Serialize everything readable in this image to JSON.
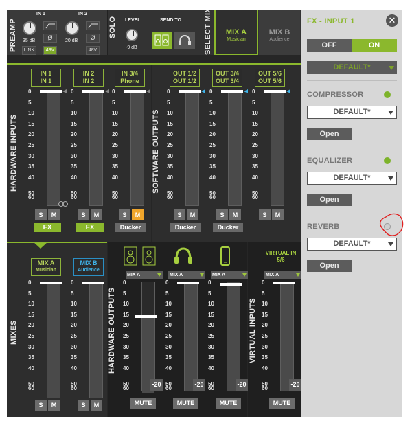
{
  "preamp": {
    "label": "PREAMP",
    "in1": "IN 1",
    "in2": "IN 2",
    "gain1": "35 dB",
    "gain2": "20 dB",
    "link": "LINK",
    "phantom1": "48V",
    "phantom2": "48V",
    "phase": "Ø"
  },
  "solo": "SOLO",
  "level": {
    "label": "LEVEL",
    "value": "-9 dB"
  },
  "sendto": "SEND TO",
  "selectmix": "SELECT MIX",
  "mixA": {
    "name": "MIX A",
    "sub": "Musician"
  },
  "mixB": {
    "name": "MIX B",
    "sub": "Audience"
  },
  "sections": {
    "hwin": "HARDWARE INPUTS",
    "swout": "SOFTWARE OUTPUTS",
    "mixes": "MIXES",
    "hwout": "HARDWARE OUTPUTS",
    "vin": "VIRTUAL INPUTS"
  },
  "scale": [
    "0",
    "5",
    "10",
    "15",
    "20",
    "25",
    "30",
    "35",
    "40",
    "50",
    "60"
  ],
  "hwin_channels": [
    {
      "l1": "IN 1",
      "l2": "IN 1",
      "btn": "FX"
    },
    {
      "l1": "IN 2",
      "l2": "IN 2",
      "btn": "FX"
    },
    {
      "l1": "IN 3/4",
      "l2": "Phone",
      "btn": "Ducker"
    }
  ],
  "sw_channels": [
    {
      "l1": "OUT 1/2",
      "l2": "OUT 1/2",
      "btn": "Ducker"
    },
    {
      "l1": "OUT 3/4",
      "l2": "OUT 3/4",
      "btn": "Ducker"
    },
    {
      "l1": "OUT 5/6",
      "l2": "OUT 5/6",
      "btn": ""
    }
  ],
  "s": "S",
  "m": "M",
  "virtual_in": {
    "l1": "VIRTUAL IN",
    "l2": "5/6"
  },
  "mixsel": "MIX A",
  "minus20": "-20",
  "mute": "MUTE",
  "fx": {
    "title": "FX - INPUT 1",
    "off": "OFF",
    "on": "ON",
    "preset": "DEFAULT*",
    "compressor": "COMPRESSOR",
    "equalizer": "EQUALIZER",
    "reverb": "REVERB",
    "default": "DEFAULT*",
    "open": "Open"
  },
  "colors": {
    "green": "#8bb82d",
    "blue": "#2a8fc4",
    "orange": "#f0a52b"
  }
}
